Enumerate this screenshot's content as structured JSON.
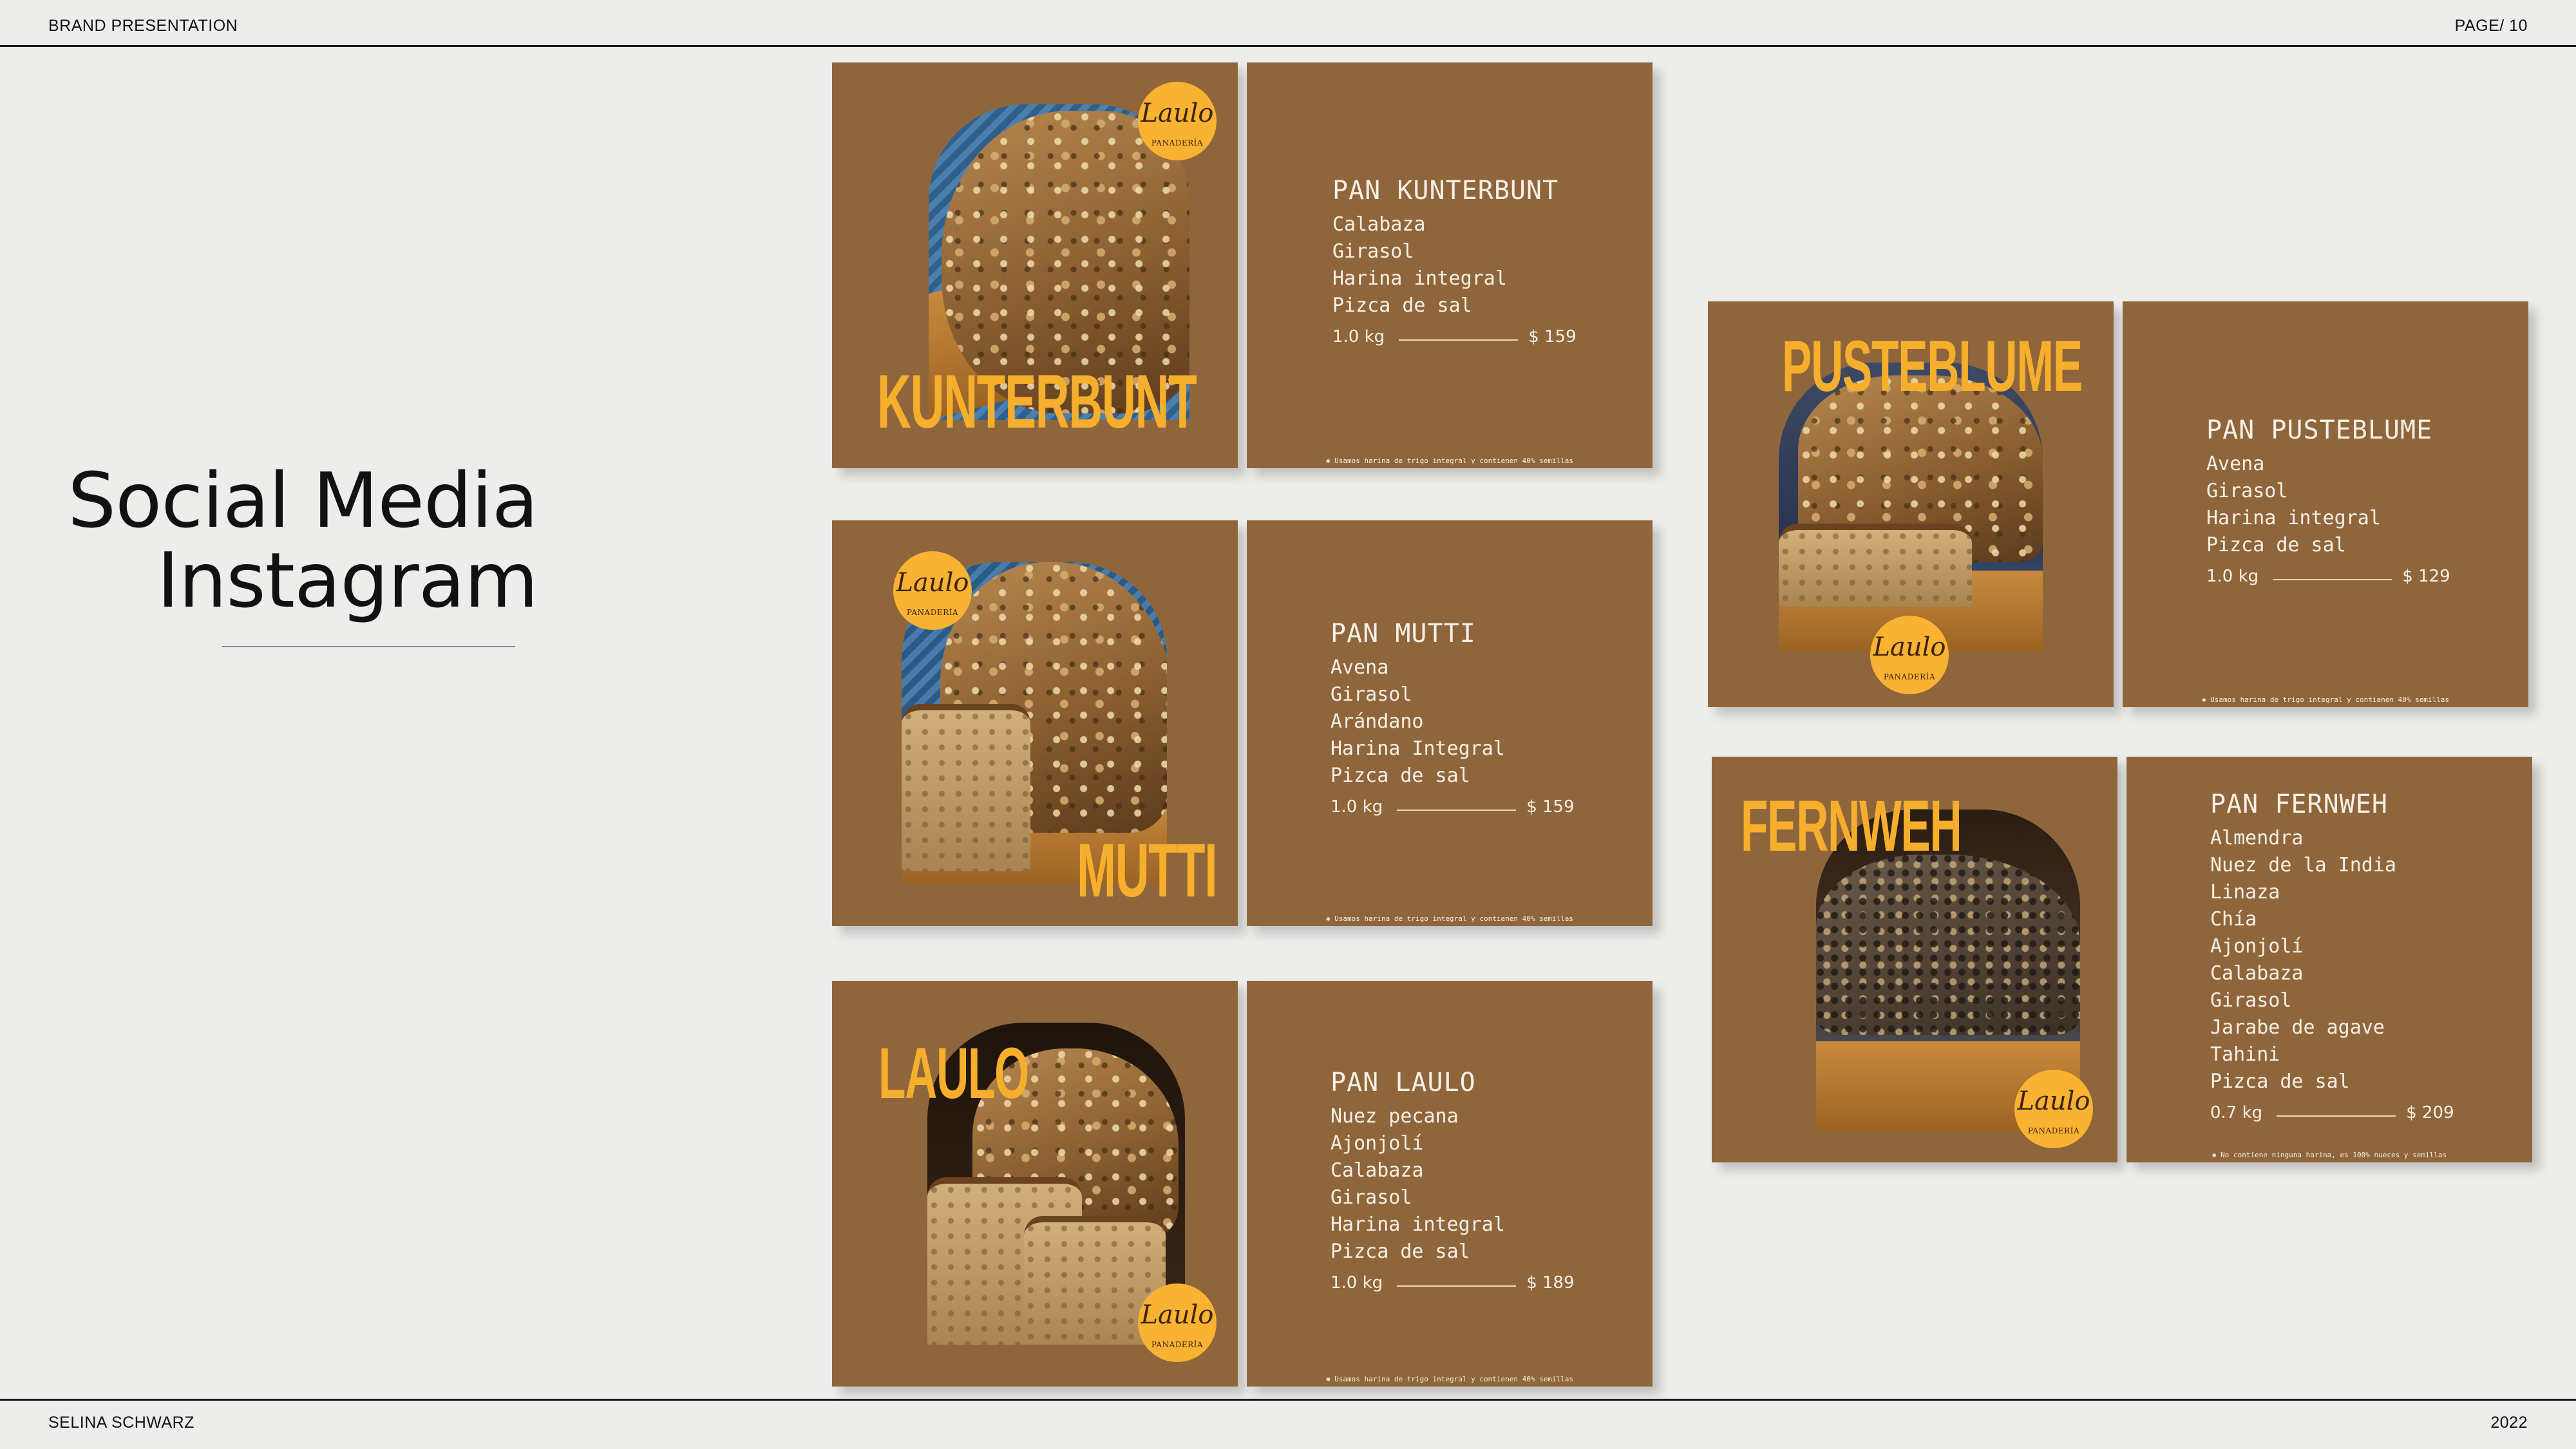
{
  "header": {
    "left": "BRAND PRESENTATION",
    "right": "PAGE/ 10"
  },
  "footer": {
    "left": "SELINA SCHWARZ",
    "right": "2022"
  },
  "section_title": {
    "line1": "Social Media",
    "line2": "Instagram"
  },
  "logo": {
    "script": "Laulo",
    "sub": "PANADERÍA"
  },
  "colors": {
    "card": "#8f663b",
    "accent": "#f6ae2d",
    "logo": "#f9b232",
    "background": "#ededeb"
  },
  "products": [
    {
      "display_name": "KUNTERBUNT",
      "name": "PAN KUNTERBUNT",
      "ingredients": [
        "Calabaza",
        "Girasol",
        "Harina integral",
        "Pizca de sal"
      ],
      "weight": "1.0 kg",
      "price": "$ 159",
      "note": "✱ Usamos harina de trigo integral y contienen 40% semillas"
    },
    {
      "display_name": "MUTTI",
      "name": "PAN MUTTI",
      "ingredients": [
        "Avena",
        "Girasol",
        "Arándano",
        "Harina Integral",
        "Pizca de sal"
      ],
      "weight": "1.0 kg",
      "price": "$ 159",
      "note": "✱ Usamos harina de trigo integral y contienen 40% semillas"
    },
    {
      "display_name": "LAULO",
      "name": "PAN LAULO",
      "ingredients": [
        "Nuez pecana",
        "Ajonjolí",
        "Calabaza",
        "Girasol",
        "Harina integral",
        "Pizca de sal"
      ],
      "weight": "1.0 kg",
      "price": "$ 189",
      "note": "✱ Usamos harina de trigo integral y contienen 40% semillas"
    },
    {
      "display_name": "PUSTEBLUME",
      "name": "PAN PUSTEBLUME",
      "ingredients": [
        "Avena",
        "Girasol",
        "Harina integral",
        "Pizca de sal"
      ],
      "weight": "1.0 kg",
      "price": "$ 129",
      "note": "✱ Usamos harina de trigo integral y contienen 40% semillas"
    },
    {
      "display_name": "FERNWEH",
      "name": "PAN FERNWEH",
      "ingredients": [
        "Almendra",
        "Nuez de la India",
        "Linaza",
        "Chía",
        "Ajonjolí",
        "Calabaza",
        "Girasol",
        "Jarabe de agave",
        "Tahini",
        "Pizca de sal"
      ],
      "weight": "0.7 kg",
      "price": "$ 209",
      "note": "✱ No contiene ninguna harina, es 100% nueces y semillas"
    }
  ]
}
